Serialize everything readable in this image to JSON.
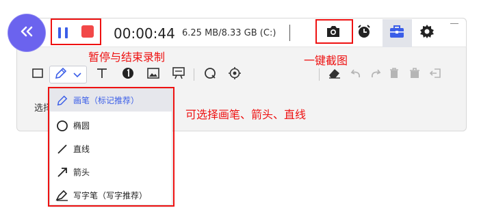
{
  "recorder": {
    "timer": "00:00:44",
    "size": "6.25 MB/8.33 GB (C:)"
  },
  "annotations": {
    "pause_stop": "暂停与结束录制",
    "screenshot": "一键截图",
    "pen_options": "可选择画笔、箭头、直线"
  },
  "toolbar": {
    "choose_label": "选择"
  },
  "pen_menu": {
    "items": [
      {
        "label": "画笔（标记推荐）",
        "icon": "pen-icon"
      },
      {
        "label": "椭圆",
        "icon": "ellipse-icon"
      },
      {
        "label": "直线",
        "icon": "line-icon"
      },
      {
        "label": "箭头",
        "icon": "arrow-icon"
      },
      {
        "label": "写字笔（写字推荐）",
        "icon": "writing-pen-icon"
      }
    ],
    "selected_index": 0
  },
  "colors": {
    "accent": "#3b5ee8",
    "stop": "#f24848",
    "highlight": "#ee1111",
    "collapse_bg": "#6b63ee"
  }
}
